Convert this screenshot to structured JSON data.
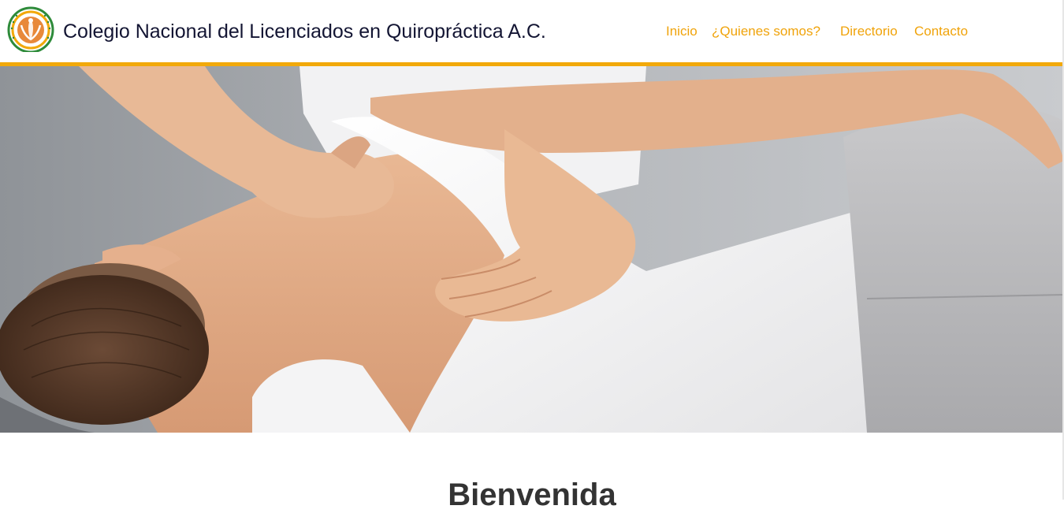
{
  "header": {
    "site_title": "Colegio Nacional del Licenciados en Quiropráctica A.C.",
    "nav": {
      "inicio": "Inicio",
      "quienes": "¿Quienes somos?",
      "directorio": "Directorio",
      "contacto": "Contacto"
    }
  },
  "hero": {
    "image": "chiropractic-back-treatment-photo"
  },
  "main": {
    "welcome_heading": "Bienvenida"
  },
  "colors": {
    "nav_link": "#f0a30a",
    "accent_line": "#f2a90a",
    "title_text": "#131533",
    "heading_text": "#333333"
  }
}
